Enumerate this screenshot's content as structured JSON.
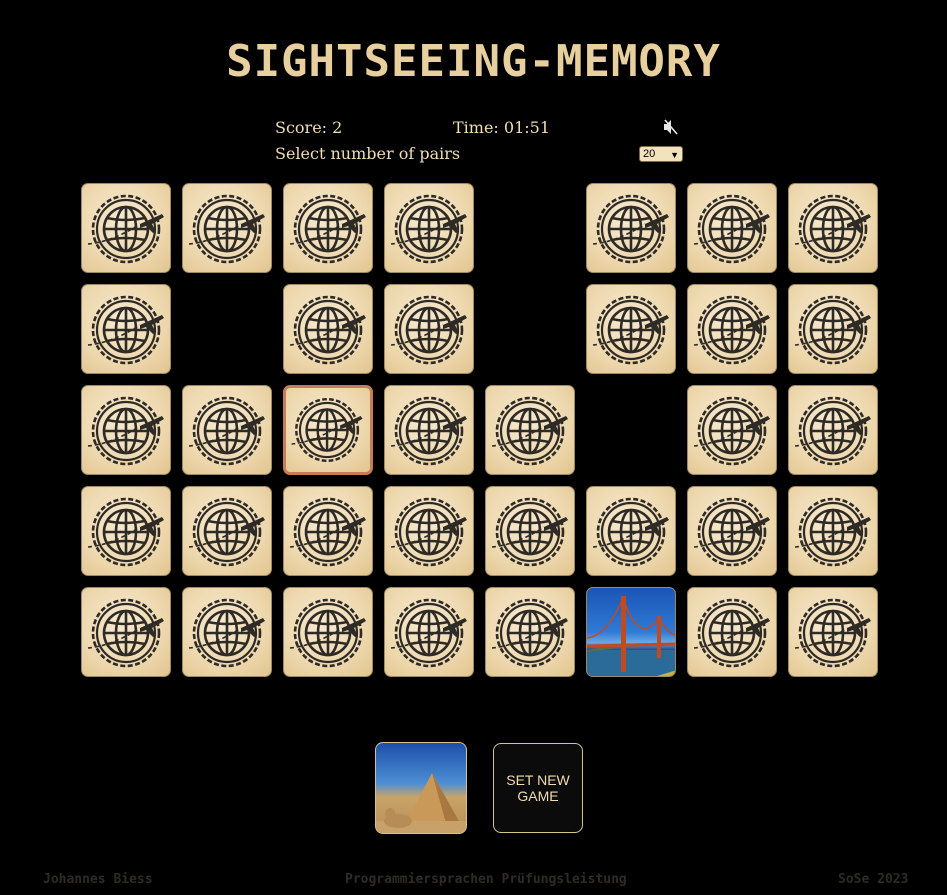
{
  "title": "SIGHTSEEING-MEMORY",
  "status": {
    "score": "Score: 2",
    "time": "Time: 01:51",
    "pairs_label": "Select number of pairs",
    "pairs_value": "20",
    "sound": "muted"
  },
  "board": {
    "rows": 5,
    "cols": 8,
    "cards": [
      "back",
      "back",
      "back",
      "back",
      "empty",
      "back",
      "back",
      "back",
      "back",
      "empty",
      "back",
      "back",
      "empty",
      "back",
      "back",
      "back",
      "back",
      "back",
      "selected",
      "back",
      "back",
      "empty",
      "back",
      "back",
      "back",
      "back",
      "back",
      "back",
      "back",
      "back",
      "back",
      "back",
      "back",
      "back",
      "back",
      "back",
      "back",
      "golden-gate-bridge-photo",
      "back",
      "back"
    ]
  },
  "controls": {
    "last_match_image": "pyramids-photo",
    "new_game_label": "SET NEW GAME"
  },
  "footer": {
    "author": "Johannes Biess",
    "course": "Programmiersprachen Prüfungsleistung",
    "term": "SoSe 2023"
  },
  "colors": {
    "background": "#000000",
    "title": "#e8cf9e",
    "card": "#eed9b0",
    "selected_border": "#c47c5a"
  }
}
